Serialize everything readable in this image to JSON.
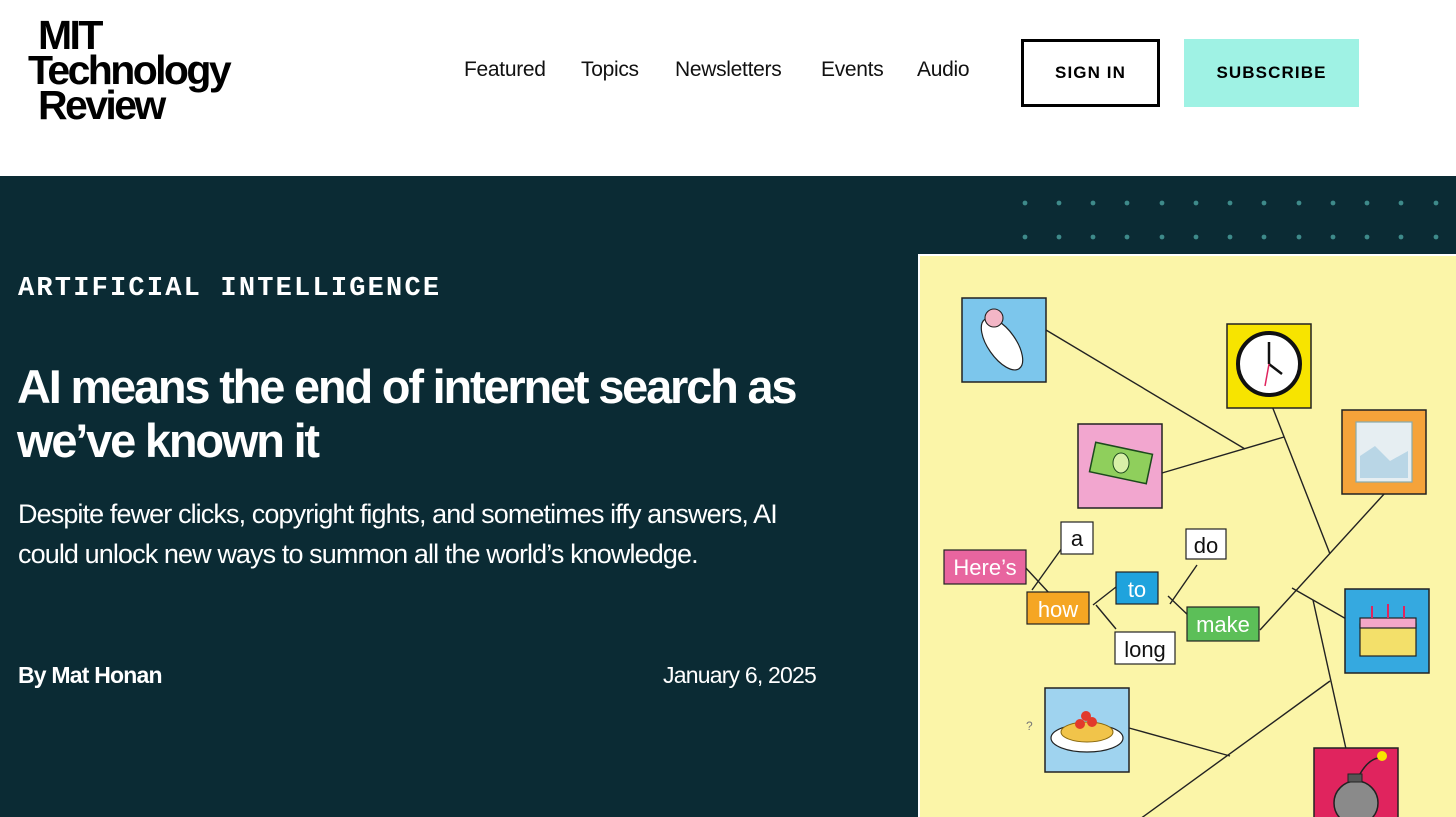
{
  "header": {
    "logo": {
      "line1": "MIT",
      "line2": "Technology",
      "line3": "Review"
    },
    "nav": [
      {
        "label": "Featured"
      },
      {
        "label": "Topics"
      },
      {
        "label": "Newsletters"
      },
      {
        "label": "Events"
      },
      {
        "label": "Audio"
      }
    ],
    "sign_in_label": "SIGN IN",
    "subscribe_label": "SUBSCRIBE"
  },
  "hero": {
    "category": "ARTIFICIAL INTELLIGENCE",
    "headline": "AI means the end of internet search as we’ve known it",
    "dek": "Despite fewer clicks, copyright fights, and sometimes iffy answers, AI could unlock new ways to summon all the world’s knowledge.",
    "byline_prefix": "By",
    "author": "Mat Honan",
    "date": "January 6, 2025",
    "illustration": {
      "words": [
        "Here’s",
        "a",
        "how",
        "to",
        "long",
        "do",
        "make"
      ],
      "question_mark": "?"
    }
  },
  "colors": {
    "hero_background": "#0b2b34",
    "subscribe_button": "#9ff2e4",
    "illustration_background": "#fbf5a8"
  }
}
